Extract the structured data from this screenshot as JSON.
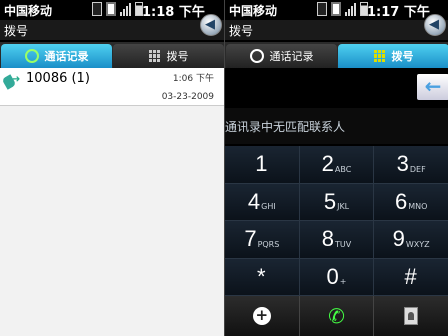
{
  "left": {
    "status": {
      "carrier": "中国移动",
      "time": "1:18 下午"
    },
    "title": "拨号",
    "tabs": [
      {
        "label": "通话记录",
        "active": true
      },
      {
        "label": "拨号",
        "active": false
      }
    ],
    "calls": [
      {
        "name": "10086 (1)",
        "time": "1:06 下午",
        "date": "03-23-2009"
      }
    ]
  },
  "right": {
    "status": {
      "carrier": "中国移动",
      "time": "1:17 下午"
    },
    "title": "拨号",
    "tabs": [
      {
        "label": "通话记录",
        "active": false
      },
      {
        "label": "拨号",
        "active": true
      }
    ],
    "delete_glyph": "←",
    "no_match_text": "通讯录中无匹配联系人",
    "keys": [
      {
        "digit": "1",
        "letters": ""
      },
      {
        "digit": "2",
        "letters": "ABC"
      },
      {
        "digit": "3",
        "letters": "DEF"
      },
      {
        "digit": "4",
        "letters": "GHI"
      },
      {
        "digit": "5",
        "letters": "JKL"
      },
      {
        "digit": "6",
        "letters": "MNO"
      },
      {
        "digit": "7",
        "letters": "PQRS"
      },
      {
        "digit": "8",
        "letters": "TUV"
      },
      {
        "digit": "9",
        "letters": "WXYZ"
      },
      {
        "digit": "*",
        "letters": ""
      },
      {
        "digit": "0",
        "letters": "+"
      },
      {
        "digit": "#",
        "letters": ""
      }
    ]
  },
  "colors": {
    "active_tab": "#1a8fc8",
    "call_green": "#44ff44",
    "delete_blue": "#4aa0e0"
  },
  "icons": {
    "history_tab": "clock-icon",
    "dial_tab": "keypad-grid-icon",
    "back": "back-arrow-icon"
  }
}
